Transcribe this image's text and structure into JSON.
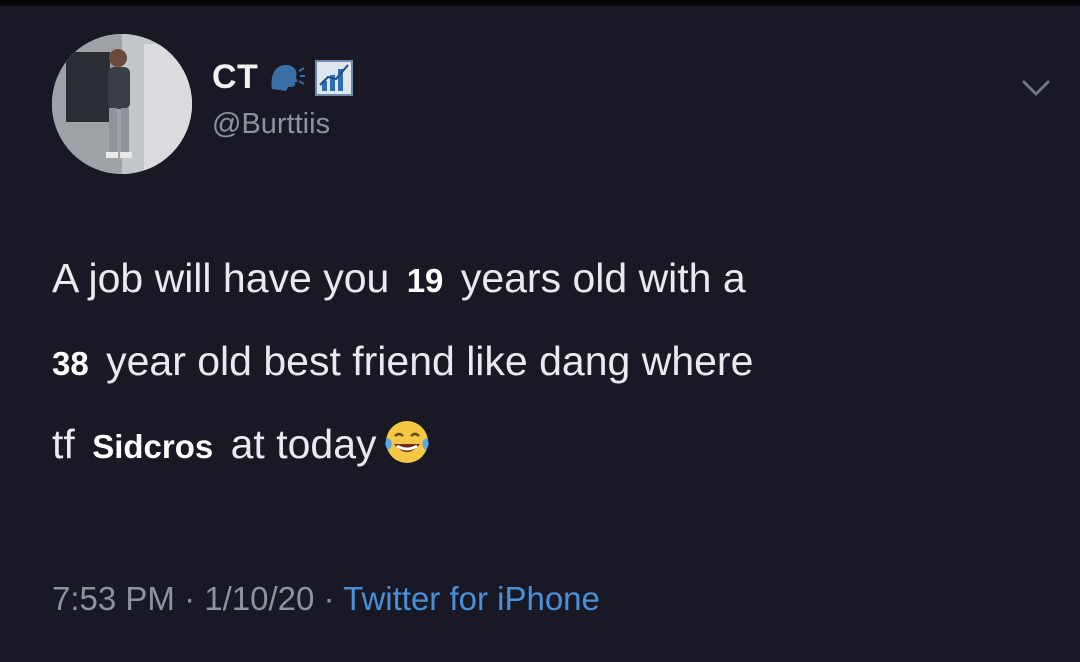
{
  "user": {
    "display_name": "CT",
    "handle": "@Burttiis",
    "name_emojis": [
      "speaking-head-icon",
      "chart-increasing-icon"
    ]
  },
  "tweet": {
    "segments": [
      "A job will have you ",
      "19",
      " years old with a",
      "38",
      " year old best friend like dang where",
      "tf ",
      "Sidcros",
      " at today"
    ],
    "emoji": "face-with-tears-of-joy-icon"
  },
  "meta": {
    "time": "7:53 PM",
    "separator": "·",
    "date": "1/10/20",
    "source": "Twitter for iPhone"
  },
  "colors": {
    "background": "#181924",
    "text": "#e9eaee",
    "muted": "#8b93a1",
    "link": "#4a90d9"
  }
}
